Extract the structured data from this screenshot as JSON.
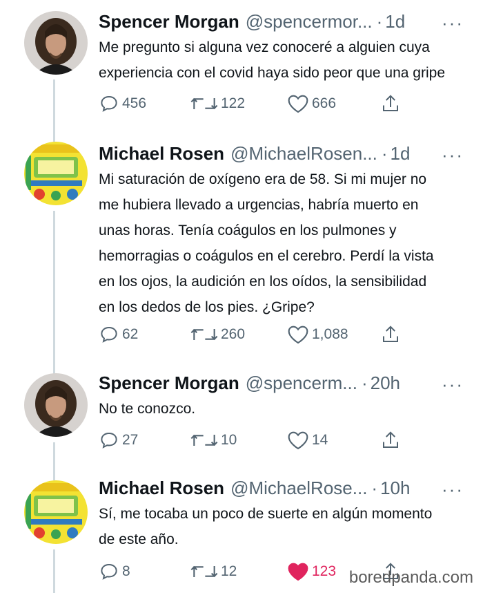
{
  "tweets": [
    {
      "name": "Spencer Morgan",
      "handle": "@spencermor...",
      "time": "1d",
      "text_lines": [
        "Me pregunto si alguna vez conoceré a alguien cuya",
        "experiencia con el covid haya sido peor que una gripe"
      ],
      "replies": "456",
      "retweets": "122",
      "likes": "666",
      "liked": false,
      "avatar": "man-portrait"
    },
    {
      "name": "Michael Rosen",
      "handle": "@MichaelRosen...",
      "time": "1d",
      "text_lines": [
        "Mi saturación de oxígeno era de 58. Si mi mujer no",
        "me hubiera llevado a urgencias, habría muerto en",
        "unas horas. Tenía coágulos en los pulmones y",
        "hemorragias o coágulos en el cerebro. Perdí la vista",
        "en los ojos, la audición en los oídos, la sensibilidad",
        "en los dedos de los pies. ¿Gripe?"
      ],
      "replies": "62",
      "retweets": "260",
      "likes": "1,088",
      "liked": false,
      "avatar": "book-cover"
    },
    {
      "name": "Spencer Morgan",
      "handle": "@spencerm...",
      "time": "20h",
      "text_lines": [
        "No te conozco."
      ],
      "replies": "27",
      "retweets": "10",
      "likes": "14",
      "liked": false,
      "avatar": "man-portrait"
    },
    {
      "name": "Michael Rosen",
      "handle": "@MichaelRose...",
      "time": "10h",
      "text_lines": [
        "Sí, me tocaba un poco de suerte en algún momento",
        "de este año."
      ],
      "replies": "8",
      "retweets": "12",
      "likes": "123",
      "liked": true,
      "avatar": "book-cover"
    }
  ],
  "separator_dot": "·",
  "more_glyph": "···",
  "watermark": "boredpanda.com",
  "colors": {
    "text": "#0f1419",
    "muted": "#536471",
    "like": "#e0245e",
    "thread": "#cfd9de"
  }
}
